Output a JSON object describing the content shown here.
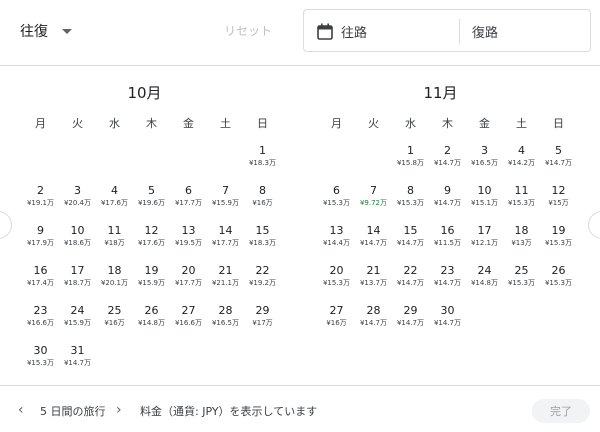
{
  "header": {
    "trip_type": "往復",
    "reset_label": "リセット",
    "outbound_placeholder": "往路",
    "inbound_placeholder": "復路"
  },
  "months": [
    {
      "title": "10月",
      "weekdays": [
        "月",
        "火",
        "水",
        "木",
        "金",
        "土",
        "日"
      ],
      "first_weekday_index": 6,
      "days": [
        {
          "d": "1",
          "p": "¥18.3万"
        },
        {
          "d": "2",
          "p": "¥19.1万"
        },
        {
          "d": "3",
          "p": "¥20.4万"
        },
        {
          "d": "4",
          "p": "¥17.6万"
        },
        {
          "d": "5",
          "p": "¥19.6万"
        },
        {
          "d": "6",
          "p": "¥17.7万"
        },
        {
          "d": "7",
          "p": "¥15.9万"
        },
        {
          "d": "8",
          "p": "¥16万"
        },
        {
          "d": "9",
          "p": "¥17.9万"
        },
        {
          "d": "10",
          "p": "¥18.6万"
        },
        {
          "d": "11",
          "p": "¥18万"
        },
        {
          "d": "12",
          "p": "¥17.6万"
        },
        {
          "d": "13",
          "p": "¥19.5万"
        },
        {
          "d": "14",
          "p": "¥17.7万"
        },
        {
          "d": "15",
          "p": "¥18.3万"
        },
        {
          "d": "16",
          "p": "¥17.4万"
        },
        {
          "d": "17",
          "p": "¥18.7万"
        },
        {
          "d": "18",
          "p": "¥20.1万"
        },
        {
          "d": "19",
          "p": "¥15.9万"
        },
        {
          "d": "20",
          "p": "¥17.7万"
        },
        {
          "d": "21",
          "p": "¥21.1万"
        },
        {
          "d": "22",
          "p": "¥19.2万"
        },
        {
          "d": "23",
          "p": "¥16.6万"
        },
        {
          "d": "24",
          "p": "¥15.9万"
        },
        {
          "d": "25",
          "p": "¥16万"
        },
        {
          "d": "26",
          "p": "¥14.8万"
        },
        {
          "d": "27",
          "p": "¥16.6万"
        },
        {
          "d": "28",
          "p": "¥16.5万"
        },
        {
          "d": "29",
          "p": "¥17万"
        },
        {
          "d": "30",
          "p": "¥15.3万"
        },
        {
          "d": "31",
          "p": "¥14.7万"
        }
      ]
    },
    {
      "title": "11月",
      "weekdays": [
        "月",
        "火",
        "水",
        "木",
        "金",
        "土",
        "日"
      ],
      "first_weekday_index": 2,
      "days": [
        {
          "d": "1",
          "p": "¥15.8万"
        },
        {
          "d": "2",
          "p": "¥14.7万"
        },
        {
          "d": "3",
          "p": "¥16.5万"
        },
        {
          "d": "4",
          "p": "¥14.2万"
        },
        {
          "d": "5",
          "p": "¥14.7万"
        },
        {
          "d": "6",
          "p": "¥15.3万"
        },
        {
          "d": "7",
          "p": "¥9.72万",
          "low": true
        },
        {
          "d": "8",
          "p": "¥15.3万"
        },
        {
          "d": "9",
          "p": "¥14.7万"
        },
        {
          "d": "10",
          "p": "¥15.1万"
        },
        {
          "d": "11",
          "p": "¥15.3万"
        },
        {
          "d": "12",
          "p": "¥15万"
        },
        {
          "d": "13",
          "p": "¥14.4万"
        },
        {
          "d": "14",
          "p": "¥14.7万"
        },
        {
          "d": "15",
          "p": "¥14.7万"
        },
        {
          "d": "16",
          "p": "¥11.5万"
        },
        {
          "d": "17",
          "p": "¥12.1万"
        },
        {
          "d": "18",
          "p": "¥13万"
        },
        {
          "d": "19",
          "p": "¥15.3万"
        },
        {
          "d": "20",
          "p": "¥15.3万"
        },
        {
          "d": "21",
          "p": "¥13.7万"
        },
        {
          "d": "22",
          "p": "¥14.7万"
        },
        {
          "d": "23",
          "p": "¥14.7万"
        },
        {
          "d": "24",
          "p": "¥14.8万"
        },
        {
          "d": "25",
          "p": "¥15.3万"
        },
        {
          "d": "26",
          "p": "¥15.3万"
        },
        {
          "d": "27",
          "p": "¥16万"
        },
        {
          "d": "28",
          "p": "¥14.7万"
        },
        {
          "d": "29",
          "p": "¥14.7万"
        },
        {
          "d": "30",
          "p": "¥14.7万"
        }
      ]
    }
  ],
  "footer": {
    "prev_icon": "chevron-left-icon",
    "next_icon": "chevron-right-icon",
    "trip_length": "5 日間の旅行",
    "price_note": "料金（通貨: JPY）を表示しています",
    "done_label": "完了"
  },
  "colors": {
    "low_price": "#188038",
    "border": "#dadce0"
  }
}
